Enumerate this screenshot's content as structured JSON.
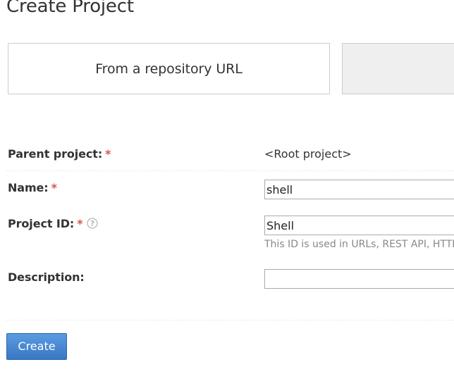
{
  "page": {
    "title": "Create Project"
  },
  "source_options": {
    "repository_url_label": "From a repository URL",
    "other_label": ""
  },
  "form": {
    "parent_project": {
      "label": "Parent project:",
      "required_marker": "*",
      "value": "<Root project>"
    },
    "name": {
      "label": "Name:",
      "required_marker": "*",
      "value": "shell"
    },
    "project_id": {
      "label": "Project ID:",
      "required_marker": "*",
      "help_icon": "question-circle-icon",
      "value": "Shell",
      "hint": "This ID is used in URLs, REST API, HTTP"
    },
    "description": {
      "label": "Description:",
      "value": ""
    }
  },
  "actions": {
    "create_label": "Create"
  },
  "colors": {
    "required": "#d9534f",
    "primary_button": "#3f82cf",
    "hint_text": "#888888",
    "help_icon": "#b8b8b8"
  }
}
